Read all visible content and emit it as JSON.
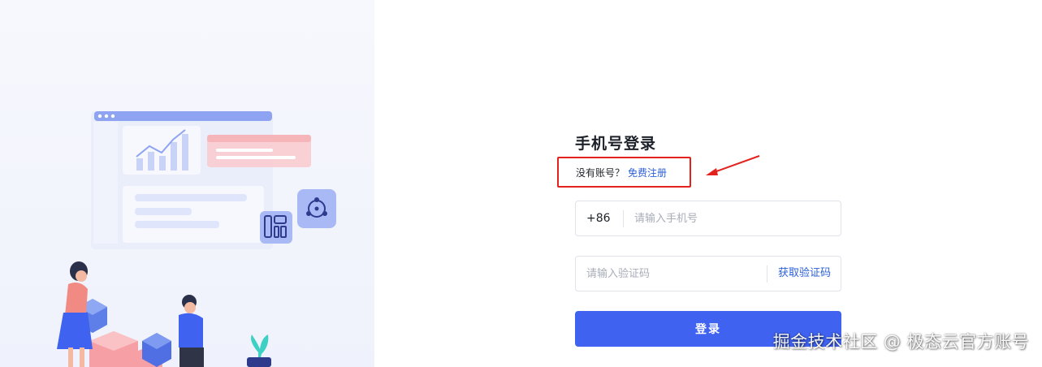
{
  "login": {
    "title": "手机号登录",
    "no_account_text": "没有账号？",
    "register_link": "免费注册",
    "phone_prefix": "+86",
    "phone_placeholder": "请输入手机号",
    "code_placeholder": "请输入验证码",
    "get_code_label": "获取验证码",
    "submit_label": "登录"
  },
  "watermark": "掘金技术社区 @ 极态云官方账号",
  "colors": {
    "primary": "#3f63f0",
    "link": "#2b5fd9",
    "annotation": "#e4221d",
    "left_panel_bg": "#f3f5fd"
  },
  "icons": {
    "chart": "chart-icon",
    "layout": "layout-icon",
    "network": "network-icon",
    "arrow": "annotation-arrow-icon"
  }
}
